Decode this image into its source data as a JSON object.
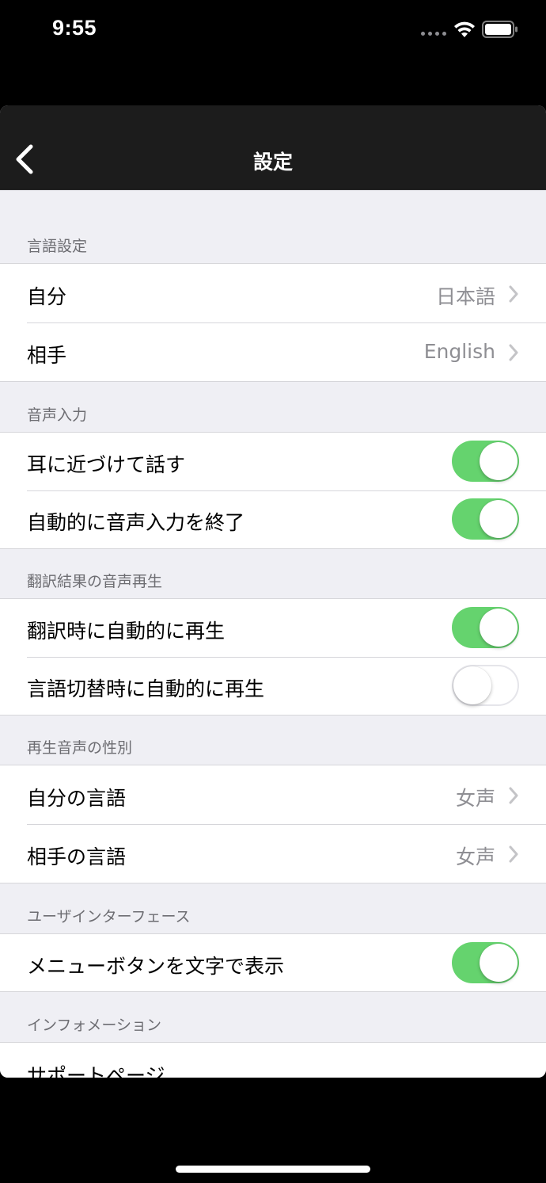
{
  "status_bar": {
    "time": "9:55"
  },
  "nav": {
    "title": "設定"
  },
  "sections": {
    "language": {
      "header": "言語設定",
      "rows": [
        {
          "label": "自分",
          "value": "日本語"
        },
        {
          "label": "相手",
          "value": "English"
        }
      ]
    },
    "voice_input": {
      "header": "音声入力",
      "rows": [
        {
          "label": "耳に近づけて話す",
          "toggle": true
        },
        {
          "label": "自動的に音声入力を終了",
          "toggle": true
        }
      ]
    },
    "playback": {
      "header": "翻訳結果の音声再生",
      "rows": [
        {
          "label": "翻訳時に自動的に再生",
          "toggle": true
        },
        {
          "label": "言語切替時に自動的に再生",
          "toggle": false
        }
      ]
    },
    "gender": {
      "header": "再生音声の性別",
      "rows": [
        {
          "label": "自分の言語",
          "value": "女声"
        },
        {
          "label": "相手の言語",
          "value": "女声"
        }
      ]
    },
    "ui": {
      "header": "ユーザインターフェース",
      "rows": [
        {
          "label": "メニューボタンを文字で表示",
          "toggle": true
        }
      ]
    },
    "info": {
      "header": "インフォメーション",
      "rows": [
        {
          "label": "サポートページ"
        }
      ]
    }
  },
  "colors": {
    "toggle_on": "#65d36e",
    "background": "#efeff4",
    "nav_bar": "#1c1c1c"
  }
}
